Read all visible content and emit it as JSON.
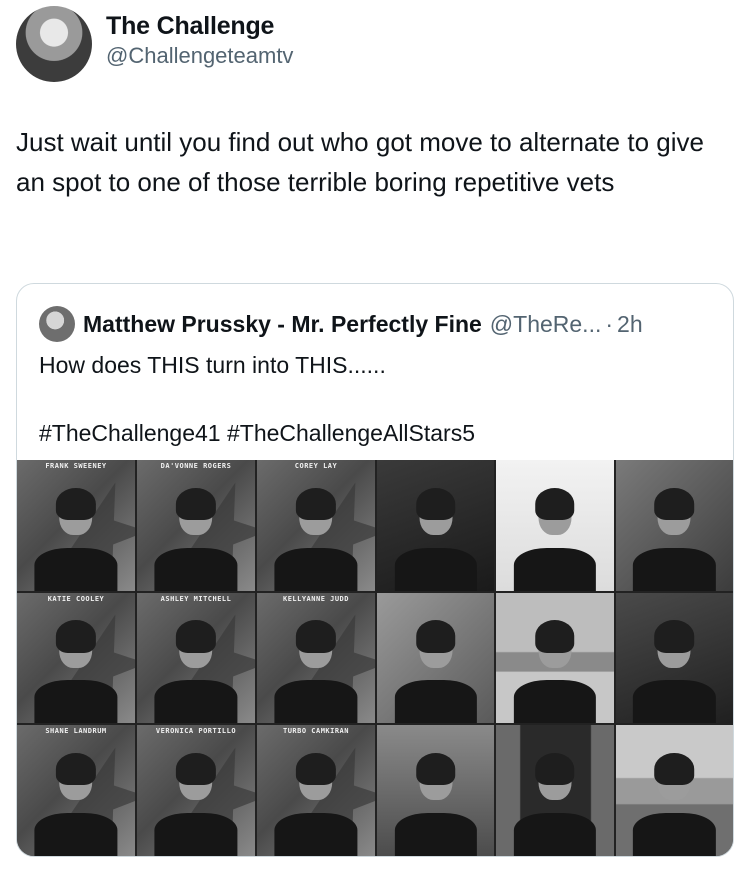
{
  "tweet": {
    "author": {
      "display_name": "The Challenge",
      "handle": "@Challengeteamtv"
    },
    "text": "Just wait until you find out who got move to alternate to give an spot to one of those terrible boring repetitive vets"
  },
  "quote": {
    "author": {
      "display_name": "Matthew Prussky - Mr. Perfectly Fine",
      "handle": "@TheRe...",
      "separator": "·",
      "time": "2h"
    },
    "text_line1": "How does THIS turn into THIS......",
    "hashtags": "#TheChallenge41 #TheChallengeAllStars5",
    "cast_labels": [
      "FRANK SWEENEY",
      "DA'VONNE ROGERS",
      "COREY LAY",
      "KATIE COOLEY",
      "ASHLEY MITCHELL",
      "KELLYANNE JUDD",
      "SHANE LANDRUM",
      "VERONICA PORTILLO",
      "TURBO CAMKIRAN"
    ]
  }
}
